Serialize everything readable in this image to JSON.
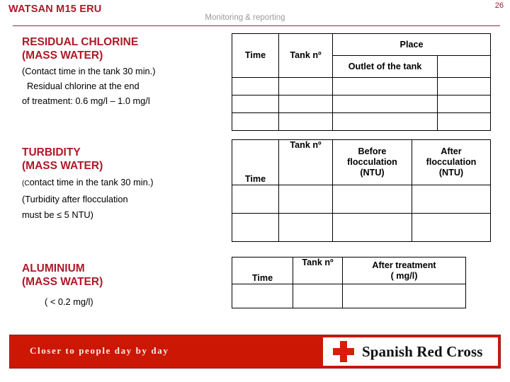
{
  "header": {
    "deck_title": "WATSAN M15 ERU",
    "section_label": "Monitoring & reporting",
    "page_number": "26"
  },
  "sections": [
    {
      "title_line1": "RESIDUAL CHLORINE",
      "title_line2": "(MASS WATER)",
      "notes": [
        "(Contact time in the tank 30 min.)",
        "Residual chlorine at the end",
        "of treatment: 0.6 mg/l – 1.0 mg/l"
      ]
    },
    {
      "title_line1": "TURBIDITY",
      "title_line2": "(MASS WATER)",
      "notes": [
        "(Contact time in the tank 30 min.)",
        "(Turbidity after flocculation",
        "must be ≤ 5 NTU)"
      ]
    },
    {
      "title_line1": "ALUMINIUM",
      "title_line2": "(MASS WATER)",
      "notes": [
        "( < 0.2 mg/l)"
      ]
    }
  ],
  "tables": {
    "chlorine": {
      "headers": {
        "time": "Time",
        "tank": "Tank nº",
        "place": "Place",
        "place_sub_left": "Outlet of the tank",
        "place_sub_right": ""
      },
      "empty_rows": 3
    },
    "turbidity": {
      "headers": {
        "time": "Time",
        "tank": "Tank nº",
        "before": "Before\nflocculation\n(NTU)",
        "before_l1": "Before",
        "before_l2": "flocculation",
        "before_l3": "(NTU)",
        "after_l1": "After",
        "after_l2": "flocculation",
        "after_l3": "(NTU)"
      },
      "empty_rows": 2
    },
    "aluminium": {
      "headers": {
        "time": "Time",
        "tank": "Tank nº",
        "after_l1": "After treatment",
        "after_l2": "( mg/l)"
      },
      "empty_rows": 1
    }
  },
  "footer": {
    "tagline": "Closer to people day by day",
    "org_name": "Spanish Red Cross"
  },
  "colors": {
    "brand_red": "#b01828",
    "banner_red": "#cc1705",
    "cross_red": "#d61f06",
    "rule": "#8f2a44",
    "muted_text": "#9b9b9b"
  }
}
